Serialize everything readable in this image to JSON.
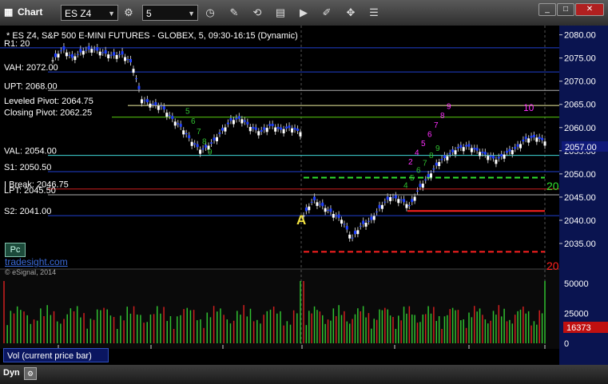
{
  "window": {
    "title": "Chart",
    "symbol": "ES Z4",
    "interval": "5",
    "min_label": "_",
    "max_label": "□",
    "close_label": "✕"
  },
  "toolbar_icons": [
    "clock-icon",
    "pencil-icon",
    "cursor-icon",
    "studies-icon",
    "play-icon",
    "edit-icon",
    "move-icon",
    "chart-list-icon"
  ],
  "chart_title": "* ES Z4, S&P 500 E-MINI FUTURES - GLOBEX, 5, 09:30-16:15 (Dynamic)",
  "price_axis": {
    "min": 2030,
    "max": 2082,
    "ticks": [
      "2080.00",
      "2075.00",
      "2070.00",
      "2065.00",
      "2060.00",
      "2055.00",
      "2050.00",
      "2045.00",
      "2040.00",
      "2035.00"
    ],
    "last_price": "2057.00"
  },
  "time_axis": {
    "ticks": [
      "08",
      "12:00",
      "14:00",
      "09",
      "12:00",
      "14:00",
      "10"
    ]
  },
  "levels": [
    {
      "label": "R1: 20",
      "value": 2077.2,
      "color": "#2040d0"
    },
    {
      "label": "VAH: 2072.00",
      "value": 2072.0,
      "color": "#2040d0"
    },
    {
      "label": "UPT: 2068.00",
      "value": 2068.0,
      "color": "#b0b0b0"
    },
    {
      "label": "Leveled Pivot: 2064.75",
      "value": 2064.75,
      "color": "#f0f0a0"
    },
    {
      "label": "Closing Pivot: 2062.25",
      "value": 2062.25,
      "color": "#58d010"
    },
    {
      "label": "VAL: 2054.00",
      "value": 2054.0,
      "color": "#40d8d8"
    },
    {
      "label": "S1: 2050.50",
      "value": 2050.5,
      "color": "#2040d0"
    },
    {
      "label": "I Break: 2046.75",
      "value": 2046.75,
      "color": "#d02020"
    },
    {
      "label": "LPT: 2045.50",
      "value": 2045.5,
      "color": "#b0b0b0"
    },
    {
      "label": "S2: 2041.00",
      "value": 2041.0,
      "color": "#2040d0"
    }
  ],
  "markers": [
    {
      "text": "A",
      "color": "#f0e040"
    },
    {
      "text": "20",
      "color": "#30e030"
    },
    {
      "text": "20",
      "color": "#ff2020"
    },
    {
      "text": "10",
      "color": "#ff30ff"
    }
  ],
  "td_count_labels": {
    "day1_green": [
      "5",
      "6",
      "7",
      "8",
      "9"
    ],
    "day2_green": [
      "4",
      "5",
      "6",
      "7",
      "8",
      "9"
    ],
    "day2_magenta": [
      "2",
      "4",
      "5",
      "6",
      "7",
      "8",
      "9"
    ]
  },
  "volume_axis": {
    "ticks": [
      "50000",
      "25000",
      "0"
    ],
    "last_volume": "16373"
  },
  "volume_label": "Vol (current price bar)",
  "left_panel": {
    "pc_label": "Pc",
    "brand": "tradesight.com",
    "copyright": "© eSignal, 2014"
  },
  "bottom": {
    "dyn_label": "Dyn"
  },
  "chart_data": {
    "type": "candlestick",
    "title": "* ES Z4, S&P 500 E-MINI FUTURES - GLOBEX, 5, 09:30-16:15 (Dynamic)",
    "day1_close_path": [
      [
        0,
        2074.5
      ],
      [
        6,
        2077
      ],
      [
        12,
        2075
      ],
      [
        18,
        2076.5
      ],
      [
        24,
        2077
      ],
      [
        30,
        2076.2
      ],
      [
        36,
        2075.5
      ],
      [
        42,
        2075.8
      ],
      [
        48,
        2073.8
      ],
      [
        54,
        2066
      ],
      [
        60,
        2065
      ],
      [
        66,
        2064.5
      ],
      [
        72,
        2062
      ],
      [
        78,
        2060
      ],
      [
        84,
        2057
      ],
      [
        90,
        2055
      ],
      [
        96,
        2056.5
      ],
      [
        102,
        2059
      ],
      [
        108,
        2061.5
      ],
      [
        114,
        2062
      ],
      [
        120,
        2060
      ],
      [
        126,
        2059
      ],
      [
        132,
        2060.5
      ],
      [
        138,
        2059.5
      ],
      [
        144,
        2060
      ],
      [
        150,
        2059
      ]
    ],
    "day2_close_path": [
      [
        0,
        2041
      ],
      [
        6,
        2044.5
      ],
      [
        12,
        2043
      ],
      [
        18,
        2041.5
      ],
      [
        24,
        2040
      ],
      [
        30,
        2036
      ],
      [
        36,
        2039
      ],
      [
        42,
        2040
      ],
      [
        48,
        2043
      ],
      [
        54,
        2045
      ],
      [
        60,
        2044.5
      ],
      [
        66,
        2043
      ],
      [
        72,
        2047
      ],
      [
        78,
        2049.5
      ],
      [
        84,
        2052.5
      ],
      [
        90,
        2054
      ],
      [
        96,
        2055.5
      ],
      [
        102,
        2056
      ],
      [
        108,
        2055
      ],
      [
        114,
        2054
      ],
      [
        120,
        2053
      ],
      [
        126,
        2054.5
      ],
      [
        132,
        2055.5
      ],
      [
        138,
        2057.5
      ],
      [
        144,
        2058
      ],
      [
        150,
        2057
      ]
    ],
    "volume_max": 60000
  }
}
